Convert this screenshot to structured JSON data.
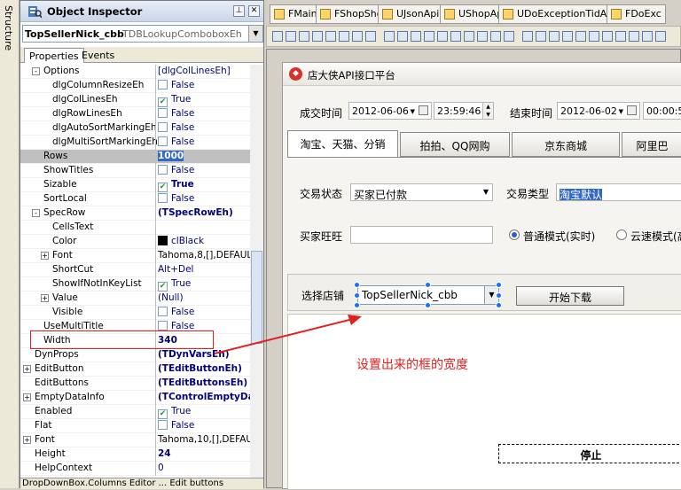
{
  "structure_tab": "Structure",
  "inspector": {
    "title": "Object Inspector",
    "component": {
      "name": "TopSellerNick_cbb",
      "class": "TDBLookupComboboxEh"
    },
    "tabs": [
      "Properties",
      "Events"
    ],
    "status": "DropDownBox.Columns Editor ... Edit buttons",
    "rows": [
      {
        "name": "Options",
        "value": "[dlgColLinesEh]",
        "indent": 1,
        "expand": "-",
        "kind": "text"
      },
      {
        "name": "dlgColumnResizeEh",
        "value": "False",
        "indent": 2,
        "kind": "check",
        "checked": false
      },
      {
        "name": "dlgColLinesEh",
        "value": "True",
        "indent": 2,
        "kind": "check",
        "checked": true
      },
      {
        "name": "dlgRowLinesEh",
        "value": "False",
        "indent": 2,
        "kind": "check",
        "checked": false
      },
      {
        "name": "dlgAutoSortMarkingEh",
        "value": "False",
        "indent": 2,
        "kind": "check",
        "checked": false
      },
      {
        "name": "dlgMultiSortMarkingEh",
        "value": "False",
        "indent": 2,
        "kind": "check",
        "checked": false
      },
      {
        "name": "Rows",
        "value": "1000",
        "indent": 1,
        "kind": "text",
        "selected": true,
        "bold": true
      },
      {
        "name": "ShowTitles",
        "value": "False",
        "indent": 1,
        "kind": "check",
        "checked": false
      },
      {
        "name": "Sizable",
        "value": "True",
        "indent": 1,
        "kind": "check",
        "checked": true,
        "bold": true
      },
      {
        "name": "SortLocal",
        "value": "False",
        "indent": 1,
        "kind": "check",
        "checked": false
      },
      {
        "name": "SpecRow",
        "value": "(TSpecRowEh)",
        "indent": 1,
        "expand": "-",
        "kind": "text",
        "bold": true
      },
      {
        "name": "CellsText",
        "value": "",
        "indent": 2,
        "kind": "text"
      },
      {
        "name": "Color",
        "value": "clBlack",
        "indent": 2,
        "kind": "color"
      },
      {
        "name": "Font",
        "value": "Tahoma,8,[],DEFAUL",
        "indent": 2,
        "expand": "+",
        "kind": "text",
        "black": true
      },
      {
        "name": "ShortCut",
        "value": "Alt+Del",
        "indent": 2,
        "kind": "text"
      },
      {
        "name": "ShowIfNotInKeyList",
        "value": "True",
        "indent": 2,
        "kind": "check",
        "checked": true
      },
      {
        "name": "Value",
        "value": "(Null)",
        "indent": 2,
        "expand": "+",
        "kind": "text"
      },
      {
        "name": "Visible",
        "value": "False",
        "indent": 2,
        "kind": "check",
        "checked": false
      },
      {
        "name": "UseMultiTitle",
        "value": "False",
        "indent": 1,
        "kind": "check",
        "checked": false
      },
      {
        "name": "Width",
        "value": "340",
        "indent": 1,
        "kind": "text",
        "bold": true
      },
      {
        "name": "DynProps",
        "value": "(TDynVarsEh)",
        "indent": 0,
        "kind": "text",
        "bold": true
      },
      {
        "name": "EditButton",
        "value": "(TEditButtonEh)",
        "indent": 0,
        "expand": "+",
        "kind": "text",
        "bold": true
      },
      {
        "name": "EditButtons",
        "value": "(TEditButtonsEh)",
        "indent": 0,
        "kind": "text",
        "bold": true
      },
      {
        "name": "EmptyDataInfo",
        "value": "(TControlEmptyDa",
        "indent": 0,
        "expand": "+",
        "kind": "text",
        "bold": true
      },
      {
        "name": "Enabled",
        "value": "True",
        "indent": 0,
        "kind": "check",
        "checked": true
      },
      {
        "name": "Flat",
        "value": "False",
        "indent": 0,
        "kind": "check",
        "checked": false
      },
      {
        "name": "Font",
        "value": "Tahoma,10,[],DEFAUL",
        "indent": 0,
        "expand": "+",
        "kind": "text",
        "black": true
      },
      {
        "name": "Height",
        "value": "24",
        "indent": 0,
        "kind": "text",
        "bold": true
      },
      {
        "name": "HelpContext",
        "value": "0",
        "indent": 0,
        "kind": "text"
      }
    ]
  },
  "editor": {
    "file_tabs": [
      "FMain",
      "FShopShow",
      "UJsonApi",
      "UShopApi",
      "UDoExceptionTidApi",
      "FDoExc"
    ],
    "form": {
      "title": "店大侠API接口平台",
      "deal_time_label": "成交时间",
      "deal_date": "2012-06-06",
      "deal_time": "23:59:46",
      "end_time_label": "结束时间",
      "end_date": "2012-06-02",
      "end_time": "00:00:52",
      "platform_tabs": [
        "淘宝、天猫、分销",
        "拍拍、QQ网购",
        "京东商城",
        "阿里巴"
      ],
      "trade_status_label": "交易状态",
      "trade_status_value": "买家已付款",
      "trade_type_label": "交易类型",
      "trade_type_value": "淘宝默认",
      "buyer_label": "买家旺旺",
      "buyer_value": "",
      "mode_normal": "普通模式(实时)",
      "mode_cloud": "云速模式(高",
      "shop_label": "选择店铺",
      "shop_value": "TopSellerNick_cbb",
      "start_button": "开始下载",
      "stop_button": "停止"
    },
    "annotation": "设置出来的框的宽度",
    "annotation_color": "#e02020"
  }
}
